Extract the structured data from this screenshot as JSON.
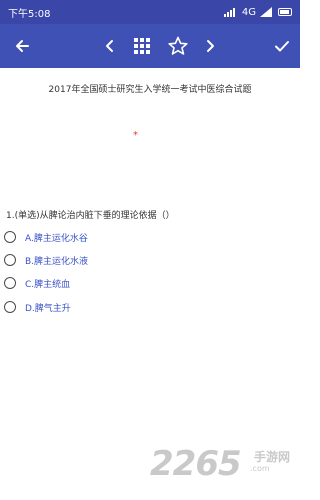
{
  "status_bar": {
    "time": "下午5:08",
    "network": "4G"
  },
  "toolbar": {
    "icons": [
      "arrow-left-icon",
      "chevron-left-icon",
      "grid-icon",
      "star-outline-icon",
      "chevron-right-icon",
      "check-icon"
    ]
  },
  "exam": {
    "title": "2017年全国硕士研究生入学统一考试中医综合试题",
    "mark": "*",
    "question": "1.(单选)从脾论治内脏下垂的理论依据（）",
    "options": [
      {
        "label": "A.脾主运化水谷"
      },
      {
        "label": "B.脾主运化水液"
      },
      {
        "label": "C.脾主统血"
      },
      {
        "label": "D.脾气主升"
      }
    ]
  },
  "watermark": {
    "brand": "2265",
    "suffix1": "手游网",
    "suffix2": ".com"
  },
  "colors": {
    "toolbar": "#3f51b5",
    "status_bar": "#3a46a8",
    "option_text": "#3a52c8",
    "mark": "#e53935"
  }
}
